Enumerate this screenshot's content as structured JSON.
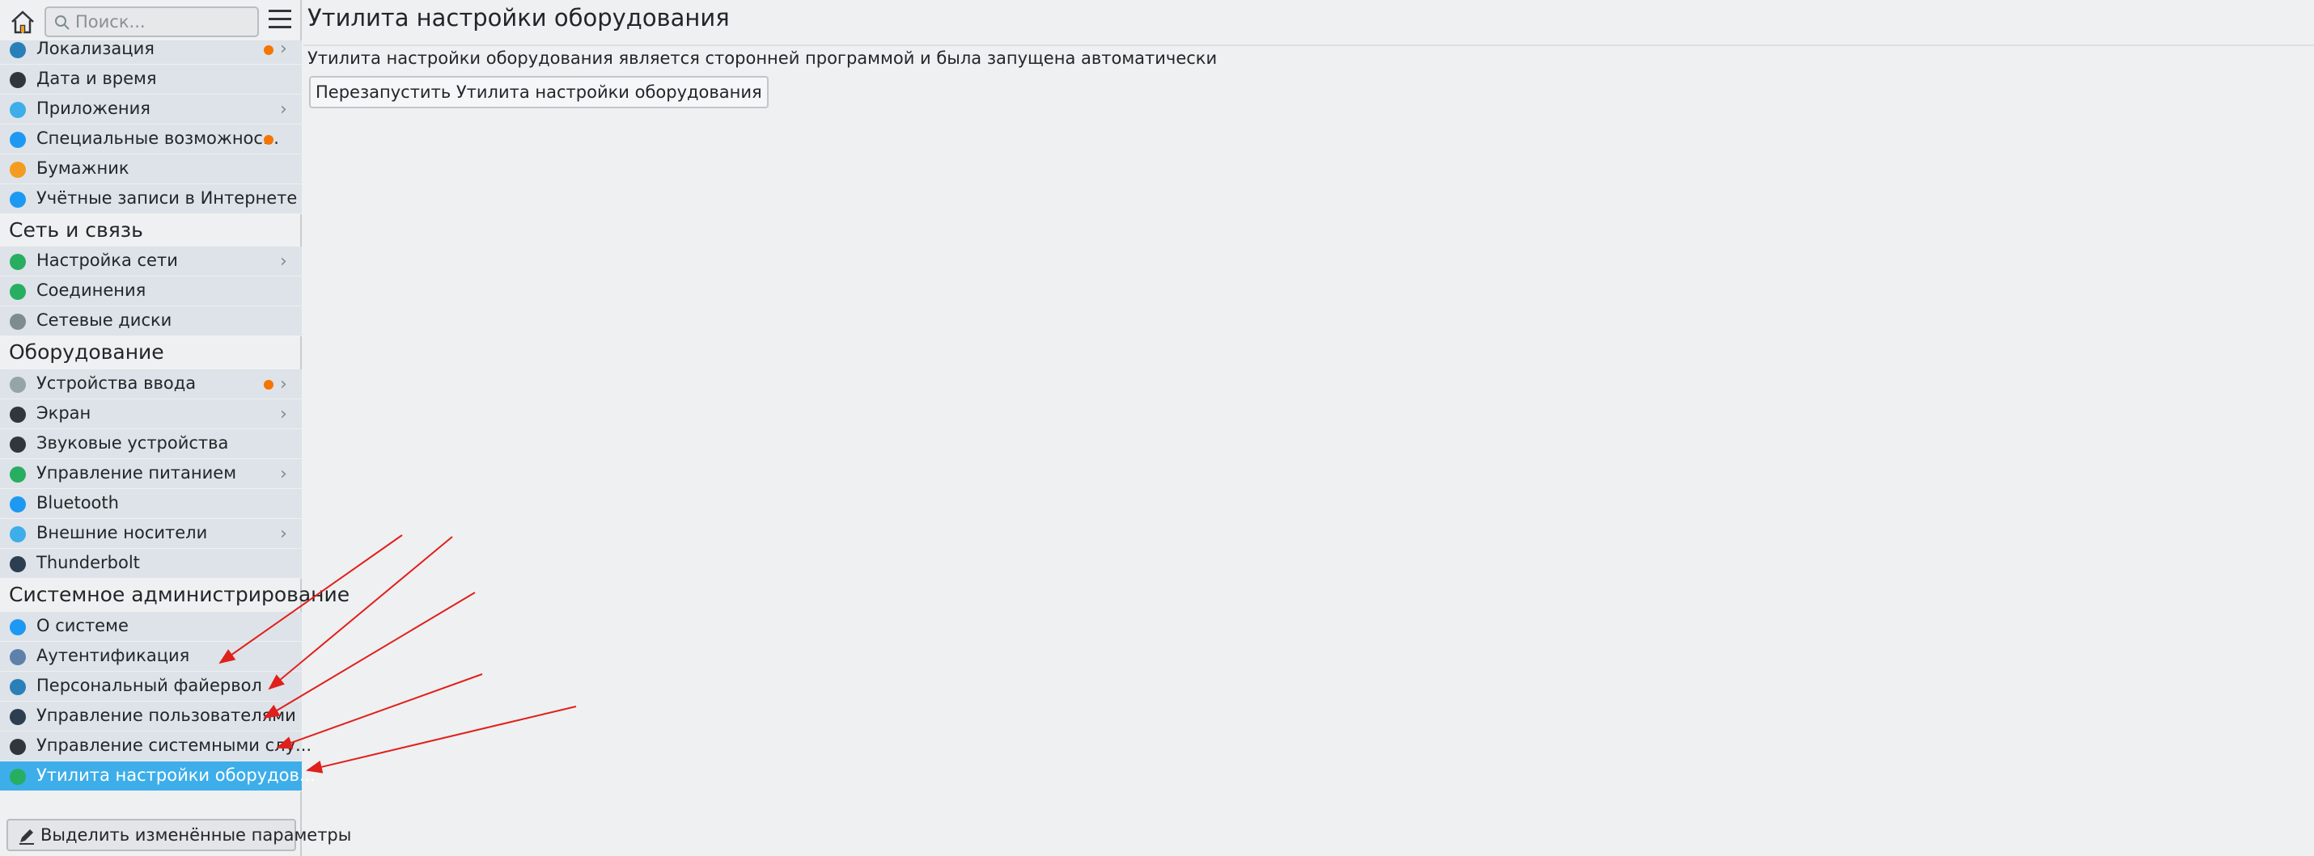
{
  "sidebar": {
    "search": {
      "placeholder": "Поиск..."
    },
    "top_items": [
      {
        "label": "Локализация",
        "icon": "flag-icon",
        "color": "#2980b9",
        "dot": true,
        "chevron": true
      },
      {
        "label": "Дата и время",
        "icon": "clock-icon",
        "color": "#31363b",
        "dot": false,
        "chevron": false
      },
      {
        "label": "Приложения",
        "icon": "apps-icon",
        "color": "#3daee9",
        "dot": false,
        "chevron": true
      },
      {
        "label": "Специальные возможнос...",
        "icon": "accessibility-icon",
        "color": "#1d99f3",
        "dot": true,
        "chevron": false
      },
      {
        "label": "Бумажник",
        "icon": "wallet-icon",
        "color": "#f39c1f",
        "dot": false,
        "chevron": false
      },
      {
        "label": "Учётные записи в Интернете",
        "icon": "globe-icon",
        "color": "#1d99f3",
        "dot": false,
        "chevron": false
      }
    ],
    "network_title": "Сеть и связь",
    "network_items": [
      {
        "label": "Настройка сети",
        "icon": "network-globe-icon",
        "color": "#27ae60",
        "dot": false,
        "chevron": true
      },
      {
        "label": "Соединения",
        "icon": "connections-icon",
        "color": "#27ae60",
        "dot": false,
        "chevron": false
      },
      {
        "label": "Сетевые диски",
        "icon": "share-icon",
        "color": "#7f8c8d",
        "dot": false,
        "chevron": false
      }
    ],
    "hardware_title": "Оборудование",
    "hardware_items": [
      {
        "label": "Устройства ввода",
        "icon": "mouse-icon",
        "color": "#95a5a6",
        "dot": true,
        "chevron": true
      },
      {
        "label": "Экран",
        "icon": "monitor-icon",
        "color": "#31363b",
        "dot": false,
        "chevron": true
      },
      {
        "label": "Звуковые устройства",
        "icon": "speaker-icon",
        "color": "#31363b",
        "dot": false,
        "chevron": false
      },
      {
        "label": "Управление питанием",
        "icon": "power-icon",
        "color": "#27ae60",
        "dot": false,
        "chevron": true
      },
      {
        "label": "Bluetooth",
        "icon": "bluetooth-icon",
        "color": "#1d99f3",
        "dot": false,
        "chevron": false
      },
      {
        "label": "Внешние носители",
        "icon": "usb-icon",
        "color": "#3daee9",
        "dot": false,
        "chevron": true
      },
      {
        "label": "Thunderbolt",
        "icon": "thunderbolt-icon",
        "color": "#2c3e50",
        "dot": false,
        "chevron": false
      }
    ],
    "admin_title": "Системное администрирование",
    "admin_items": [
      {
        "label": "О системе",
        "icon": "info-icon",
        "color": "#1d99f3",
        "dot": false,
        "chevron": false
      },
      {
        "label": "Аутентификация",
        "icon": "user-key-icon",
        "color": "#5e81ac",
        "dot": false,
        "chevron": false
      },
      {
        "label": "Персональный файервол",
        "icon": "firewall-icon",
        "color": "#2980b9",
        "dot": false,
        "chevron": false
      },
      {
        "label": "Управление пользователями",
        "icon": "users-icon",
        "color": "#2c3e50",
        "dot": false,
        "chevron": false
      },
      {
        "label": "Управление системными слу...",
        "icon": "services-icon",
        "color": "#31363b",
        "dot": false,
        "chevron": false
      },
      {
        "label": "Утилита настройки оборудов...",
        "icon": "hardware-tool-icon",
        "color": "#27ae60",
        "dot": false,
        "chevron": false
      }
    ],
    "highlight_button": "Выделить изменённые параметры"
  },
  "main": {
    "title": "Утилита настройки оборудования",
    "info": "Утилита настройки оборудования является сторонней программой и была запущена автоматически",
    "restart_button": "Перезапустить Утилита настройки оборудования"
  },
  "colors": {
    "accent": "#3daee9",
    "notification_dot": "#f67400",
    "annotation_arrow": "#e0201c"
  }
}
